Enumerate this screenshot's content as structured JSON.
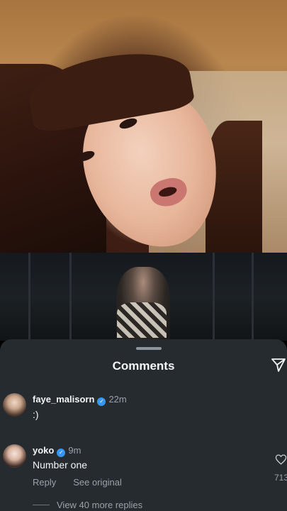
{
  "sheet": {
    "title": "Comments"
  },
  "comments": [
    {
      "username": "faye_malisorn",
      "verified": true,
      "time": "22m",
      "text": ":)"
    },
    {
      "username": "yoko",
      "verified": true,
      "time": "9m",
      "text": "Number one",
      "reply_label": "Reply",
      "see_original_label": "See original",
      "like_count": "713",
      "view_replies_label": "View 40 more replies"
    }
  ],
  "icons": {
    "share": "send-icon",
    "like": "heart-icon",
    "verified": "verified-badge-icon"
  },
  "colors": {
    "sheet_bg": "#262b30",
    "verified": "#3797f0",
    "secondary_text": "#9aa1a8"
  }
}
